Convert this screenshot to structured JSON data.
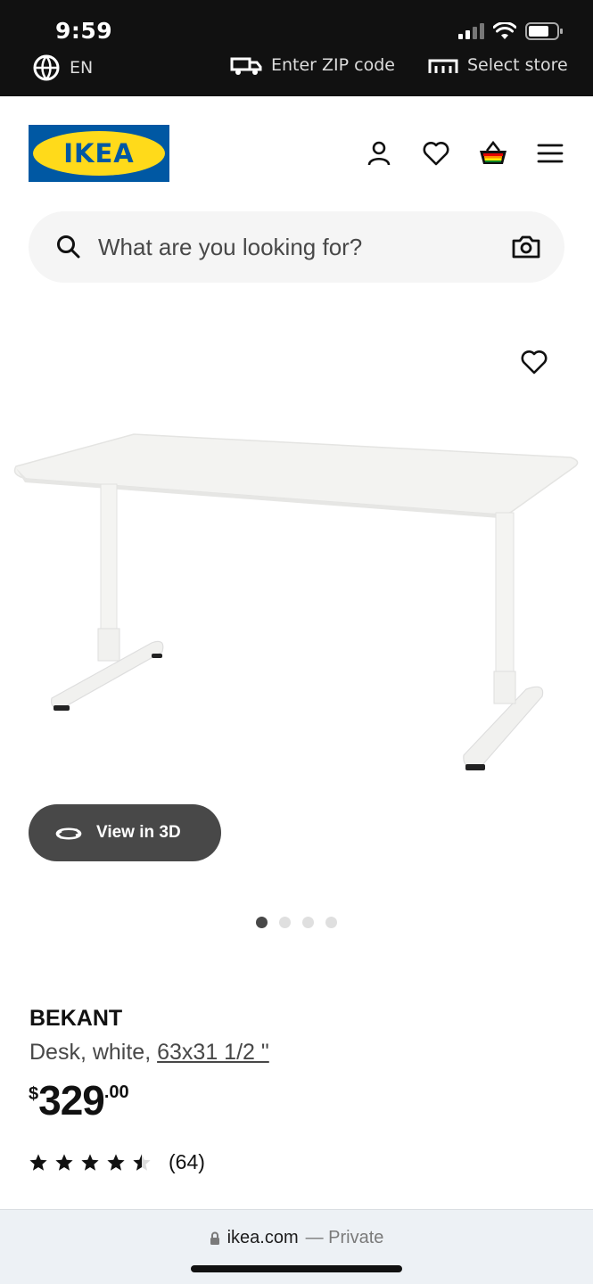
{
  "status_bar": {
    "time": "9:59"
  },
  "top_strip": {
    "language": "EN",
    "zip": "Enter ZIP code",
    "store": "Select store"
  },
  "header": {
    "logo_text": "IKEA",
    "icons": [
      "account-icon",
      "heart-icon",
      "basket-icon",
      "menu-icon"
    ]
  },
  "search": {
    "placeholder": "What are you looking for?"
  },
  "gallery": {
    "view_3d_label": "View in 3D",
    "dot_count": 4,
    "active_index": 0
  },
  "product": {
    "name": "BEKANT",
    "description_prefix": "Desk, white,",
    "size": "63x31 1/2 \"",
    "price_currency": "$",
    "price_integer": "329",
    "price_decimal": ".00",
    "rating_value": 4.5,
    "rating_max": 5,
    "review_count": "(64)"
  },
  "browser": {
    "domain": "ikea.com",
    "mode": "— Private"
  },
  "colors": {
    "ikea_blue": "#0058a3",
    "ikea_yellow": "#ffda1a",
    "dark_button": "#484848"
  }
}
